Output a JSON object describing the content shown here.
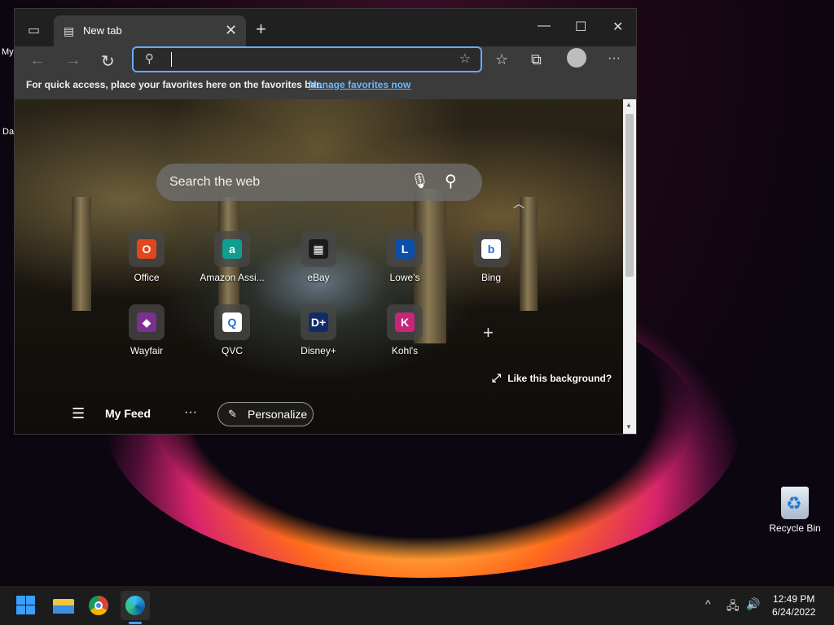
{
  "desktop": {
    "edge_text_1": "My",
    "edge_text_2": "Da",
    "recycle_bin_label": "Recycle Bin"
  },
  "browser": {
    "tab": {
      "title": "New tab",
      "close": "✕"
    },
    "new_tab": "+",
    "window_controls": {
      "minimize": "—",
      "maximize": "☐",
      "close": "✕"
    },
    "nav": {
      "back": "←",
      "forward": "→",
      "refresh": "↻",
      "more": "···"
    },
    "address_bar": {
      "value": "",
      "placeholder": ""
    },
    "favorites_bar": {
      "message": "For quick access, place your favorites here on the favorites bar.",
      "link": "Manage favorites now"
    }
  },
  "newtab": {
    "search_placeholder": "Search the web",
    "quick_links": [
      {
        "label": "Office",
        "icon": "office-icon",
        "color": "#e3461c",
        "glyph": "O"
      },
      {
        "label": "Amazon Assi...",
        "icon": "amazon-icon",
        "color": "#0f9e8f",
        "glyph": "a"
      },
      {
        "label": "eBay",
        "icon": "ebay-icon",
        "color": "#1b1b1b",
        "glyph": "▦"
      },
      {
        "label": "Lowe's",
        "icon": "lowes-icon",
        "color": "#0b4fa8",
        "glyph": "L"
      },
      {
        "label": "Bing",
        "icon": "bing-icon",
        "color": "#ffffff",
        "glyph": "b"
      },
      {
        "label": "Wayfair",
        "icon": "wayfair-icon",
        "color": "#7b2f8e",
        "glyph": "◆"
      },
      {
        "label": "QVC",
        "icon": "qvc-icon",
        "color": "#ffffff",
        "glyph": "Q"
      },
      {
        "label": "Disney+",
        "icon": "disney-icon",
        "color": "#112b66",
        "glyph": "D+"
      },
      {
        "label": "Kohl's",
        "icon": "kohls-icon",
        "color": "#c6257a",
        "glyph": "K"
      }
    ],
    "add_tile": "+",
    "like_background": "Like this background?",
    "feed": {
      "title": "My Feed",
      "more": "···",
      "personalize": "Personalize"
    }
  },
  "taskbar": {
    "clock": {
      "time": "12:49 PM",
      "date": "6/24/2022"
    },
    "tray": {
      "chevron": "^",
      "network": "🖧",
      "volume": "🔊"
    }
  },
  "colors": {
    "accent": "#6aa9ff",
    "link": "#6cb8ff",
    "start": "#3aa0ff"
  }
}
